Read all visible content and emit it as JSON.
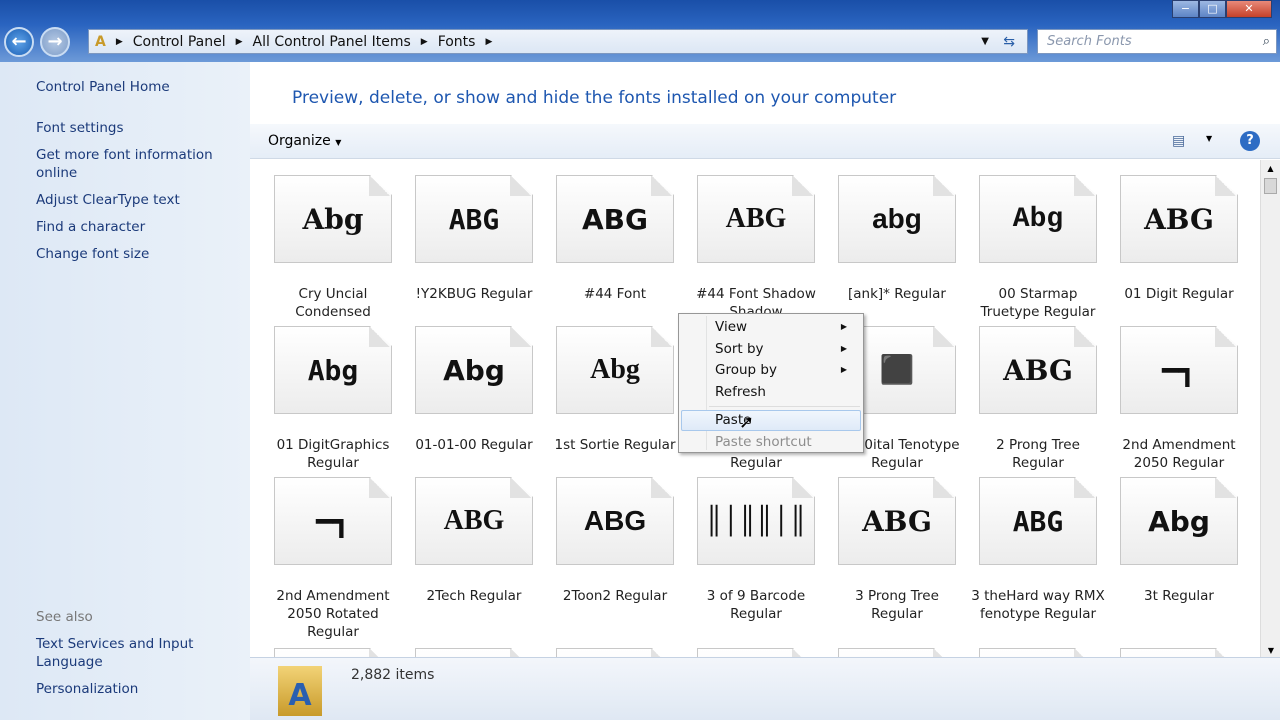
{
  "window": {
    "minimize": "−",
    "maximize": "□",
    "close": "✕"
  },
  "nav": {
    "back": "←",
    "forward": "→"
  },
  "breadcrumb": [
    "Control Panel",
    "All Control Panel Items",
    "Fonts"
  ],
  "search": {
    "placeholder": "Search Fonts"
  },
  "sidebar": {
    "items": [
      "Control Panel Home",
      "Font settings",
      "Get more font information online",
      "Adjust ClearType text",
      "Find a character",
      "Change font size"
    ],
    "see_also_title": "See also",
    "see_also": [
      "Text Services and Input Language",
      "Personalization"
    ]
  },
  "header": {
    "title": "Preview, delete, or show and hide the fonts installed on your computer"
  },
  "toolbar": {
    "organize": "Organize",
    "help": "?"
  },
  "fonts": [
    {
      "name": "Cry Uncial Condensed",
      "preview": "Abg"
    },
    {
      "name": "!Y2KBUG Regular",
      "preview": "ABG"
    },
    {
      "name": "#44 Font",
      "preview": "ABG"
    },
    {
      "name": "#44 Font Shadow Shadow",
      "preview": "ABG"
    },
    {
      "name": "[ank]* Regular",
      "preview": "abg"
    },
    {
      "name": "00 Starmap Truetype Regular",
      "preview": "Abg"
    },
    {
      "name": "01 Digit Regular",
      "preview": "ABG"
    },
    {
      "name": "01 DigitGraphics Regular",
      "preview": "Abg"
    },
    {
      "name": "01-01-00 Regular",
      "preview": "Abg"
    },
    {
      "name": "1st Sortie Regular",
      "preview": "Abg"
    },
    {
      "name": "Regular",
      "preview": ""
    },
    {
      "name": "02.10ital Tenotype Regular",
      "preview": "⬛"
    },
    {
      "name": "2 Prong Tree Regular",
      "preview": "ABG"
    },
    {
      "name": "2nd Amendment 2050 Regular",
      "preview": "━┓"
    },
    {
      "name": "2nd Amendment 2050 Rotated Regular",
      "preview": "━┓"
    },
    {
      "name": "2Tech Regular",
      "preview": "ABG"
    },
    {
      "name": "2Toon2 Regular",
      "preview": "ABG"
    },
    {
      "name": "3 of 9 Barcode Regular",
      "preview": "║│║║│║"
    },
    {
      "name": "3 Prong Tree Regular",
      "preview": "ABG"
    },
    {
      "name": "3 theHard way RMX fenotype Regular",
      "preview": "ABG"
    },
    {
      "name": "3t Regular",
      "preview": "Abg"
    }
  ],
  "context_menu": {
    "items": [
      "View",
      "Sort by",
      "Group by",
      "Refresh",
      "Paste",
      "Paste shortcut"
    ]
  },
  "status": {
    "count": "2,882 items"
  }
}
